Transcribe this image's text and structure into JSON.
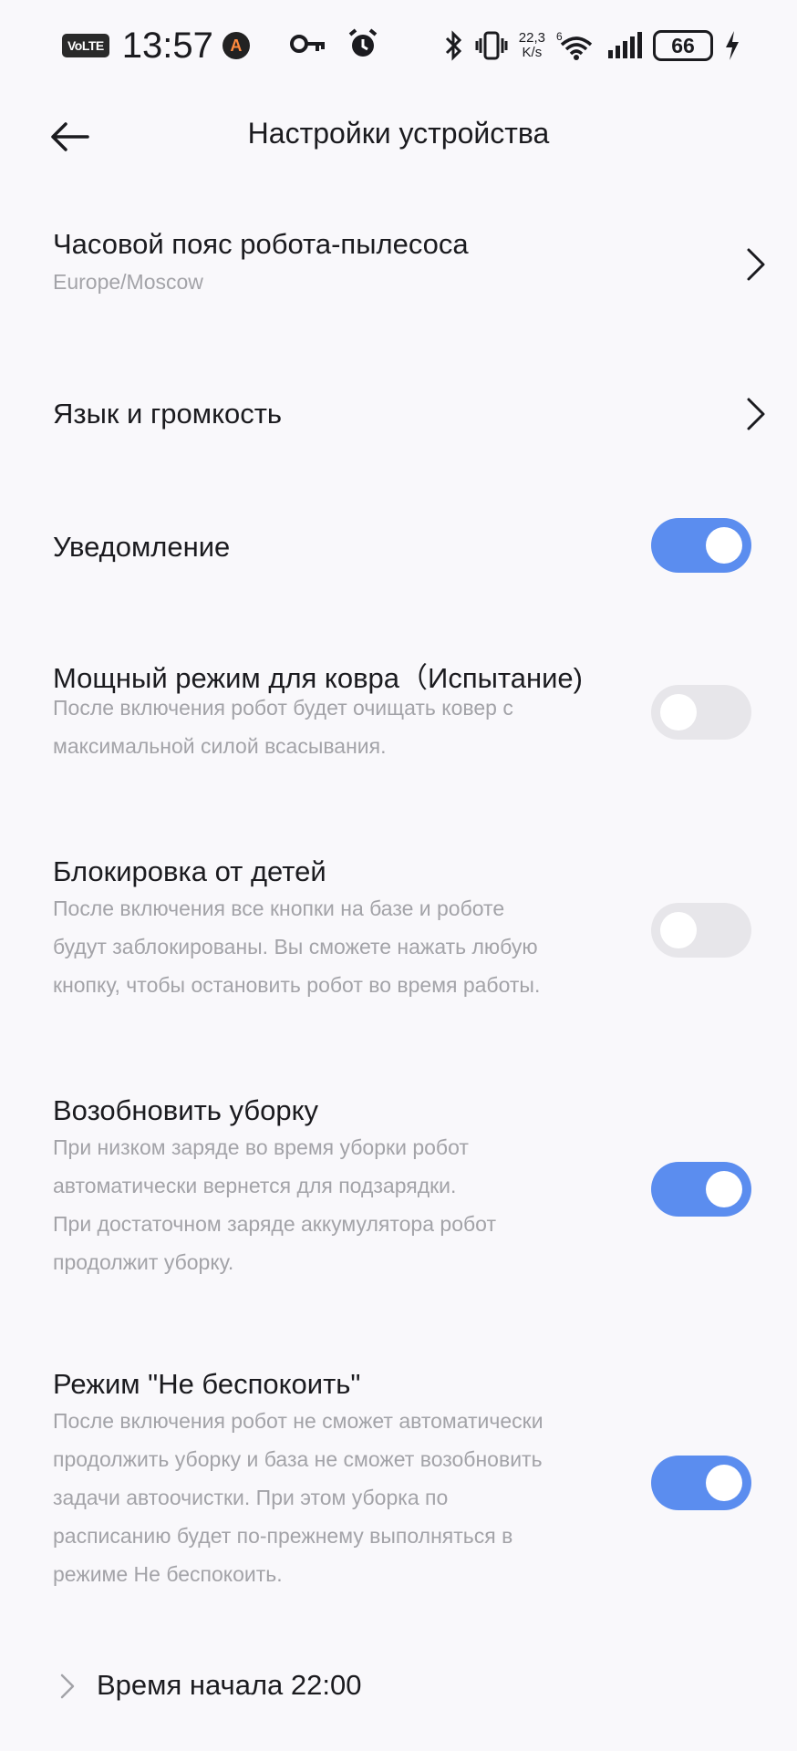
{
  "status_bar": {
    "volte": "VoLTE",
    "time": "13:57",
    "speed_value": "22,3",
    "speed_unit": "K/s",
    "network": "6",
    "battery": "66"
  },
  "header": {
    "title": "Настройки устройства"
  },
  "settings": {
    "timezone": {
      "title": "Часовой пояс робота-пылесоса",
      "value": "Europe/Moscow"
    },
    "language": {
      "title": "Язык и громкость"
    },
    "notification": {
      "title": "Уведомление",
      "enabled": true
    },
    "carpet": {
      "title": "Мощный режим для ковра（Испытание)",
      "desc": [
        "После включения робот будет очищать ковер с",
        "максимальной силой всасывания."
      ],
      "enabled": false
    },
    "child_lock": {
      "title": "Блокировка от детей",
      "desc": [
        "После включения все кнопки на базе и роботе",
        "будут заблокированы. Вы сможете нажать любую",
        "кнопку, чтобы остановить робот во время работы."
      ],
      "enabled": false
    },
    "resume": {
      "title": "Возобновить уборку",
      "desc": [
        "При низком заряде во время уборки робот",
        "автоматически вернется для подзарядки.",
        "При достаточном заряде аккумулятора робот",
        "продолжит уборку."
      ],
      "enabled": true
    },
    "dnd": {
      "title": "Режим \"Не беспокоить\"",
      "desc": [
        "После включения робот не сможет автоматически",
        "продолжить уборку и база не сможет возобновить",
        "задачи автоочистки. При этом уборка по",
        "расписанию будет по-прежнему выполняться в",
        "режиме Не беспокоить."
      ],
      "enabled": true
    },
    "start_time": {
      "label": "Время начала 22:00"
    }
  },
  "colors": {
    "accent": "#5b8def",
    "toggle_off": "#e7e6ea",
    "secondary_text": "#a3a3a8"
  }
}
